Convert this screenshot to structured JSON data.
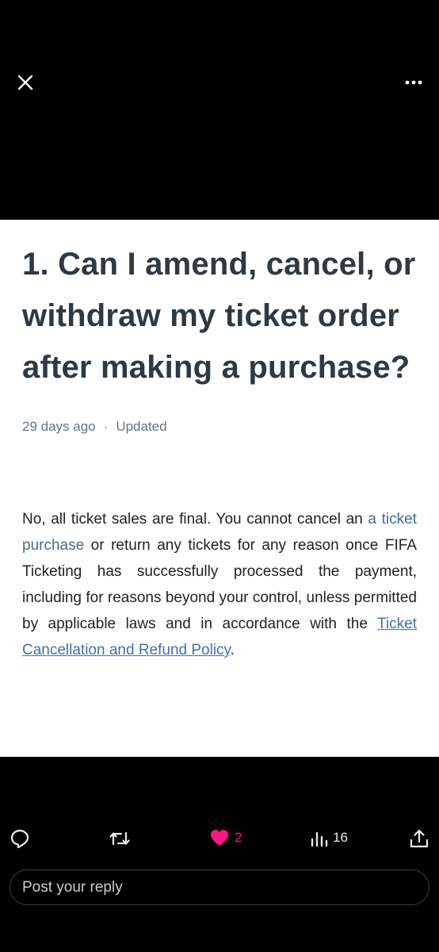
{
  "viewer": {
    "close_icon": "close-icon",
    "more_icon": "more-horizontal-icon"
  },
  "article": {
    "title": "1. Can I amend, cancel, or withdraw my ticket order after making a purchase?",
    "meta": {
      "age": "29 days ago",
      "separator": "·",
      "updated": "Updated"
    },
    "body": {
      "part1": "No, all ticket sales are final. You cannot cancel an ",
      "highlight": "a ticket purchase",
      "part2": " or return any tickets for any reason once FIFA Ticketing has successfully processed the payment, including for reasons beyond your control, unless permitted by applicable laws and in accordance with the ",
      "link": "Ticket Cancellation and Refund Policy",
      "part3": "."
    }
  },
  "actions": {
    "reply": {
      "icon": "reply-icon",
      "count": ""
    },
    "repost": {
      "icon": "repost-icon",
      "count": ""
    },
    "like": {
      "icon": "heart-icon",
      "count": "2",
      "color": "#f91880"
    },
    "views": {
      "icon": "views-icon",
      "count": "16"
    },
    "share": {
      "icon": "share-icon"
    }
  },
  "reply_box": {
    "placeholder": "Post your reply"
  },
  "colors": {
    "background": "#000000",
    "title": "#2f3941",
    "link": "#3d73b0",
    "like": "#f91880"
  }
}
